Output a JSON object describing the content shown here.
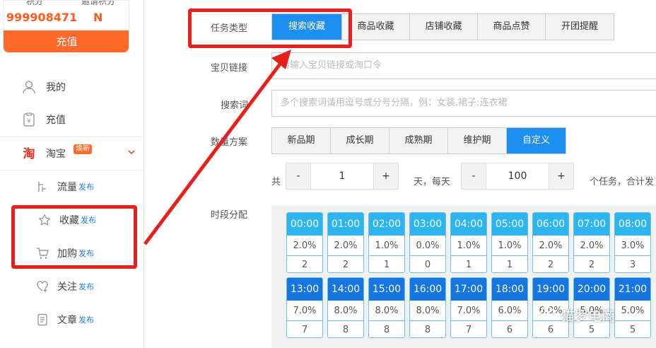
{
  "sidebar": {
    "points_caption": "积分",
    "points_value": "999908471",
    "invite_caption": "邀请积分",
    "invite_value": "N",
    "recharge_button": "充值",
    "nav": [
      {
        "label": "我的",
        "icon": "user-icon"
      },
      {
        "label": "充值",
        "icon": "wallet-icon"
      },
      {
        "label": "淘宝",
        "icon": "taobao-icon",
        "badge": "焕新"
      }
    ],
    "sub": [
      {
        "label": "流量",
        "tag": "发布",
        "icon": "traffic-icon"
      },
      {
        "label": "收藏",
        "tag": "发布",
        "icon": "star-icon"
      },
      {
        "label": "加购",
        "tag": "发布",
        "icon": "cart-icon"
      },
      {
        "label": "关注",
        "tag": "发布",
        "icon": "heart-icon"
      },
      {
        "label": "文章",
        "tag": "发布",
        "icon": "document-icon"
      }
    ]
  },
  "form": {
    "task_type_label": "任务类型",
    "task_types": [
      "搜索收藏",
      "商品收藏",
      "店铺收藏",
      "商品点赞",
      "开团提醒"
    ],
    "link_label": "宝贝链接",
    "link_placeholder": "请输入宝贝链接或淘口令",
    "keyword_label": "搜索词",
    "keyword_placeholder": "多个搜索词请用逗号或分号分隔，例：女装,裙子;连衣裙",
    "plan_label": "数量方案",
    "plans": [
      "新品期",
      "成长期",
      "成熟期",
      "维护期",
      "自定义"
    ],
    "total_prefix": "共",
    "days_value": "1",
    "days_suffix": "天，每天",
    "per_day_value": "100",
    "per_day_suffix": "个任务，合计发",
    "minus": "-",
    "plus": "+",
    "period_label": "时段分配"
  },
  "time_slots_row1": [
    {
      "time": "00:00",
      "pct": "2.0%",
      "count": "2"
    },
    {
      "time": "01:00",
      "pct": "2.0%",
      "count": "2"
    },
    {
      "time": "02:00",
      "pct": "1.0%",
      "count": "1"
    },
    {
      "time": "03:00",
      "pct": "0.0%",
      "count": "0"
    },
    {
      "time": "04:00",
      "pct": "1.0%",
      "count": "1"
    },
    {
      "time": "05:00",
      "pct": "1.0%",
      "count": "1"
    },
    {
      "time": "06:00",
      "pct": "2.0%",
      "count": "2"
    },
    {
      "time": "07:00",
      "pct": "2.0%",
      "count": "2"
    },
    {
      "time": "08:00",
      "pct": "3.0%",
      "count": "3"
    }
  ],
  "time_slots_row2": [
    {
      "time": "13:00",
      "pct": "7.0%",
      "count": "7"
    },
    {
      "time": "14:00",
      "pct": "8.0%",
      "count": "8"
    },
    {
      "time": "15:00",
      "pct": "8.0%",
      "count": "8"
    },
    {
      "time": "16:00",
      "pct": "8.0%",
      "count": "8"
    },
    {
      "time": "17:00",
      "pct": "7.0%",
      "count": "7"
    },
    {
      "time": "18:00",
      "pct": "6.0%",
      "count": "6"
    },
    {
      "time": "19:00",
      "pct": "6.0%",
      "count": "6"
    },
    {
      "time": "20:00",
      "pct": "5.0%",
      "count": "5"
    },
    {
      "time": "21:00",
      "pct": "5.0%",
      "count": "5"
    }
  ],
  "watermark": "猫罗电商",
  "colors": {
    "accent": "#1c8ff0",
    "orange": "#ff6a2a",
    "annotation_red": "#e8201c"
  }
}
